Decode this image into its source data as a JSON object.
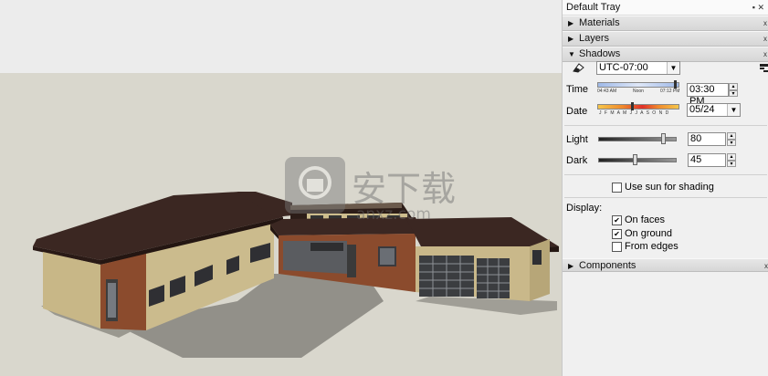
{
  "tray": {
    "title": "Default Tray",
    "pin": "▪ x",
    "sections": {
      "materials": {
        "label": "Materials",
        "expanded": false
      },
      "layers": {
        "label": "Layers",
        "expanded": false
      },
      "shadows": {
        "label": "Shadows",
        "expanded": true
      },
      "components": {
        "label": "Components",
        "expanded": false
      }
    }
  },
  "shadows": {
    "timezone": "UTC-07:00",
    "time_label": "Time",
    "time_marks": [
      "04:43 AM",
      "Noon",
      "07:12 PM"
    ],
    "time_value": "03:30 PM",
    "date_label": "Date",
    "months": "J F M A M J J A S O N D",
    "date_value": "05/24",
    "light_label": "Light",
    "light_value": "80",
    "light_level": 0.8,
    "dark_label": "Dark",
    "dark_value": "45",
    "dark_level": 0.45,
    "use_sun_label": "Use sun for shading",
    "use_sun_checked": false,
    "display_label": "Display:",
    "on_faces_label": "On faces",
    "on_faces_checked": true,
    "on_ground_label": "On ground",
    "on_ground_checked": true,
    "from_edges_label": "From edges",
    "from_edges_checked": false
  },
  "watermark": {
    "text": "安下载",
    "sub": "anxz.com"
  },
  "colors": {
    "sky": "#ececec",
    "ground": "#d8d6cc",
    "roof": "#3a2722",
    "brick": "#8a4a2e",
    "stucco": "#c9b88a",
    "shadow": "#8f8d86",
    "tray_bg": "#f0f0f0"
  },
  "icons": {
    "collapsed": "▶",
    "expanded": "▼",
    "check": "✔",
    "spin_up": "▴",
    "spin_down": "▾",
    "dropdown": "▼",
    "shadow_toggle": "eraser-icon",
    "shadow_settings": "shadow-settings-icon"
  }
}
